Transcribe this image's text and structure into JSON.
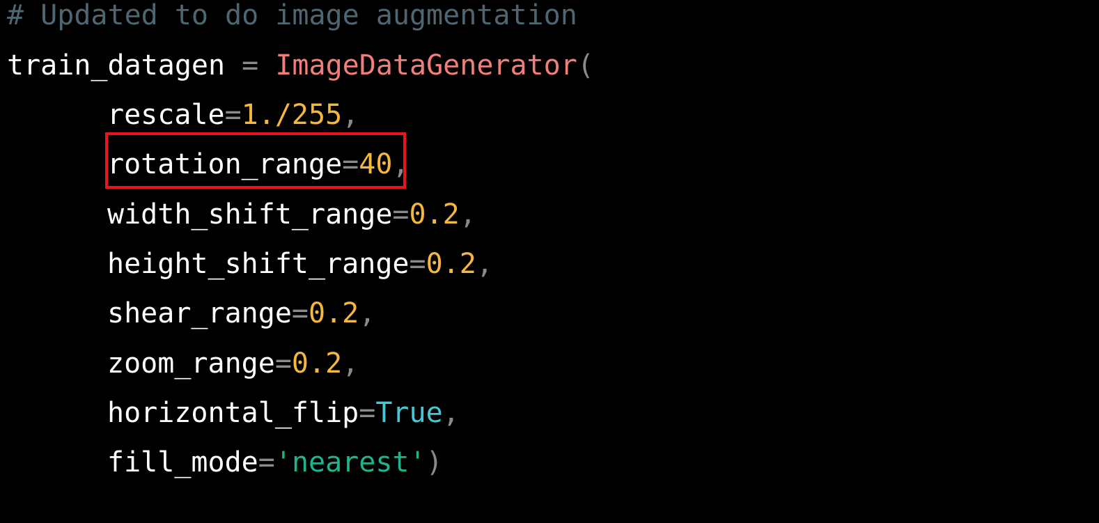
{
  "colors": {
    "background": "#000000",
    "comment": "#4f6671",
    "identifier": "#ffffff",
    "operator": "#8a8a8a",
    "class_name": "#f07f7b",
    "number": "#f5b83d",
    "boolean": "#46c8d4",
    "string": "#1fb38e",
    "highlight_box": "#e8161c"
  },
  "code": {
    "comment": "# Updated to do image augmentation",
    "assign_target": "train_datagen",
    "assign_op": " = ",
    "class_name": "ImageDataGenerator",
    "open_paren": "(",
    "eq": "=",
    "comma": ",",
    "close_paren": ")",
    "quote": "'",
    "params": [
      {
        "name": "rescale",
        "value": "1./255"
      },
      {
        "name": "rotation_range",
        "value": "40",
        "highlighted": true
      },
      {
        "name": "width_shift_range",
        "value": "0.2"
      },
      {
        "name": "height_shift_range",
        "value": "0.2"
      },
      {
        "name": "shear_range",
        "value": "0.2"
      },
      {
        "name": "zoom_range",
        "value": "0.2"
      },
      {
        "name": "horizontal_flip",
        "value": "True"
      },
      {
        "name": "fill_mode",
        "value": "nearest"
      }
    ]
  }
}
